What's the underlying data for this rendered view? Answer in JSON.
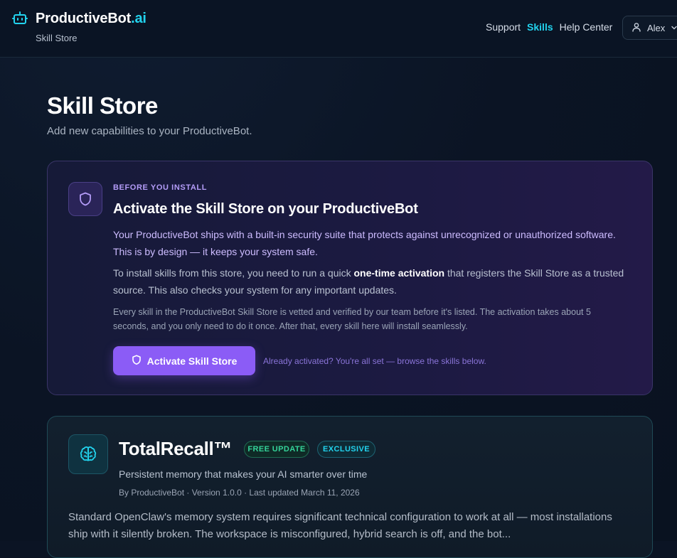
{
  "header": {
    "brand_main": "ProductiveBot",
    "brand_accent": ".ai",
    "subtitle": "Skill Store",
    "nav": [
      {
        "label": "Support"
      },
      {
        "label": "Skills"
      },
      {
        "label": "Help Center"
      }
    ],
    "user_name": "Alex",
    "logo_icon": "robot-icon",
    "user_icon": "user-icon",
    "accent_color": "#22d3ee"
  },
  "page": {
    "title": "Skill Store",
    "subtitle": "Add new capabilities to your ProductiveBot."
  },
  "notice": {
    "icon": "shield-icon",
    "eyebrow": "BEFORE YOU INSTALL",
    "title": "Activate the Skill Store on your ProductiveBot",
    "p1": "Your ProductiveBot ships with a built-in security suite that protects against unrecognized or unauthorized software. This is by design — it keeps your system safe.",
    "p2_before": "To install skills from this store, you need to run a quick ",
    "p2_bold": "one-time activation",
    "p2_after": " that registers the Skill Store as a trusted source. This also checks your system for any important updates.",
    "p3": "Every skill in the ProductiveBot Skill Store is vetted and verified by our team before it's listed. The activation takes about 5 seconds, and you only need to do it once. After that, every skill here will install seamlessly.",
    "button_label": "Activate Skill Store",
    "already_text": "Already activated? You're all set — browse the skills below.",
    "button_color": "#8b5cf6"
  },
  "skill": {
    "icon": "brain-icon",
    "name": "TotalRecall™",
    "badge_free": "FREE UPDATE",
    "badge_exclusive": "EXCLUSIVE",
    "tagline": "Persistent memory that makes your AI smarter over time",
    "meta": "By ProductiveBot · Version 1.0.0 · Last updated March 11, 2026",
    "description": "Standard OpenClaw's memory system requires significant technical configuration to work at all — most installations ship with it silently broken. The workspace is misconfigured, hybrid search is off, and the bot..."
  }
}
